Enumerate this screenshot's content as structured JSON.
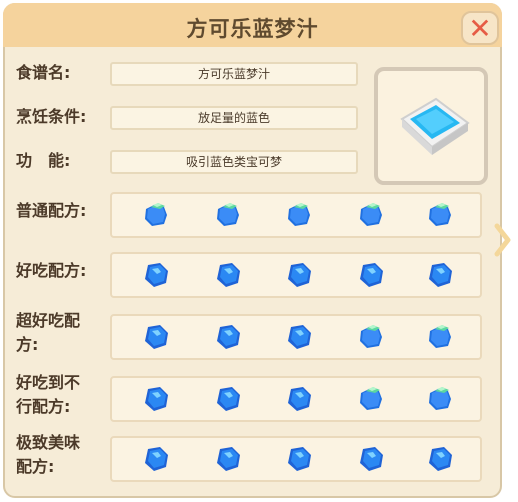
{
  "window": {
    "title": "方可乐蓝梦汁",
    "close_icon": "close-icon",
    "accent_close": "#e65c45"
  },
  "info": {
    "recipe_name_label": "食谱名:",
    "recipe_name_value": "方可乐蓝梦汁",
    "condition_label": "烹饪条件:",
    "condition_value": "放足量的蓝色",
    "function_label": "功　能:",
    "function_value": "吸引蓝色类宝可梦"
  },
  "preview": {
    "icon": "blue-pool-block-icon"
  },
  "recipes": [
    {
      "label_line1": "普通配方:",
      "label_line2": "",
      "ingredients": [
        "blue-block",
        "blue-block",
        "blue-block",
        "blue-block",
        "blue-block"
      ]
    },
    {
      "label_line1": "好吃配方:",
      "label_line2": "",
      "ingredients": [
        "blue-gem",
        "blue-gem",
        "blue-gem",
        "blue-gem",
        "blue-gem"
      ]
    },
    {
      "label_line1": "超好吃配",
      "label_line2": "方:",
      "ingredients": [
        "blue-gem",
        "blue-gem",
        "blue-gem",
        "blue-block",
        "blue-block"
      ]
    },
    {
      "label_line1": "好吃到不",
      "label_line2": "行配方:",
      "ingredients": [
        "blue-gem",
        "blue-gem",
        "blue-gem",
        "blue-block",
        "blue-block"
      ]
    },
    {
      "label_line1": "极致美味",
      "label_line2": "配方:",
      "ingredients": [
        "blue-gem",
        "blue-gem",
        "blue-gem",
        "blue-gem",
        "blue-gem"
      ]
    }
  ],
  "nav": {
    "next_icon": "chevron-right-icon"
  }
}
